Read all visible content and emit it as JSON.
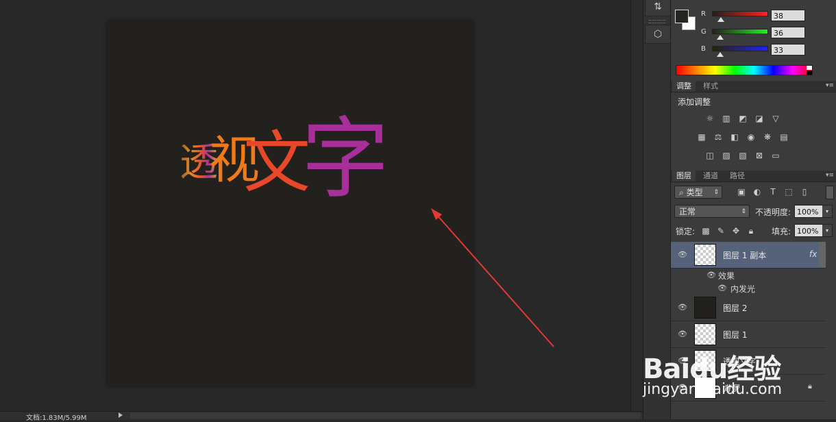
{
  "canvas": {
    "artwork_text": "透视文字",
    "artwork_chars": [
      "透",
      "视",
      "文",
      "字"
    ]
  },
  "status_bar": {
    "doc_info": "文档:1.83M/5.99M"
  },
  "color_panel": {
    "channels": [
      {
        "label": "R",
        "value": "38",
        "level": 0.149
      },
      {
        "label": "G",
        "value": "36",
        "level": 0.141
      },
      {
        "label": "B",
        "value": "33",
        "level": 0.129
      }
    ],
    "foreground_color": "#262421",
    "background_color": "#ffffff"
  },
  "adjustments_panel": {
    "tabs": [
      {
        "label": "调整",
        "active": true
      },
      {
        "label": "样式",
        "active": false
      }
    ],
    "title": "添加调整",
    "icons": [
      "brightness-icon",
      "levels-icon",
      "curves-icon",
      "exposure-icon",
      "vibrance-icon",
      "hue-saturation-icon",
      "color-balance-icon",
      "black-white-icon",
      "photo-filter-icon",
      "channel-mixer-icon",
      "color-lookup-icon",
      "invert-icon",
      "posterize-icon",
      "threshold-icon",
      "selective-color-icon",
      "gradient-map-icon"
    ]
  },
  "layers_panel": {
    "tabs": [
      {
        "label": "图层",
        "active": true
      },
      {
        "label": "通道",
        "active": false
      },
      {
        "label": "路径",
        "active": false
      }
    ],
    "filter": {
      "value": "类型"
    },
    "blend_mode": "正常",
    "opacity": {
      "label": "不透明度:",
      "value": "100%"
    },
    "lock_label": "锁定:",
    "fill": {
      "label": "填充:",
      "value": "100%"
    },
    "layers": [
      {
        "name": "图层 1 副本",
        "selected": true,
        "thumb": "checker",
        "fx": "fx"
      },
      {
        "name": "图层 2",
        "selected": false,
        "thumb": "dark"
      },
      {
        "name": "图层 1",
        "selected": false,
        "thumb": "checker"
      },
      {
        "name": "透视文字",
        "selected": false,
        "thumb": "checker"
      },
      {
        "name": "背景",
        "selected": false,
        "thumb": "white",
        "locked": true
      }
    ],
    "effects_label": "效果",
    "effect_items": [
      "内发光"
    ]
  },
  "watermark": {
    "logo": "Baidu经验",
    "url": "jingyan.baidu.com"
  },
  "colors": {
    "accent_selection": "#56627a",
    "annotation_arrow": "#e53935"
  }
}
